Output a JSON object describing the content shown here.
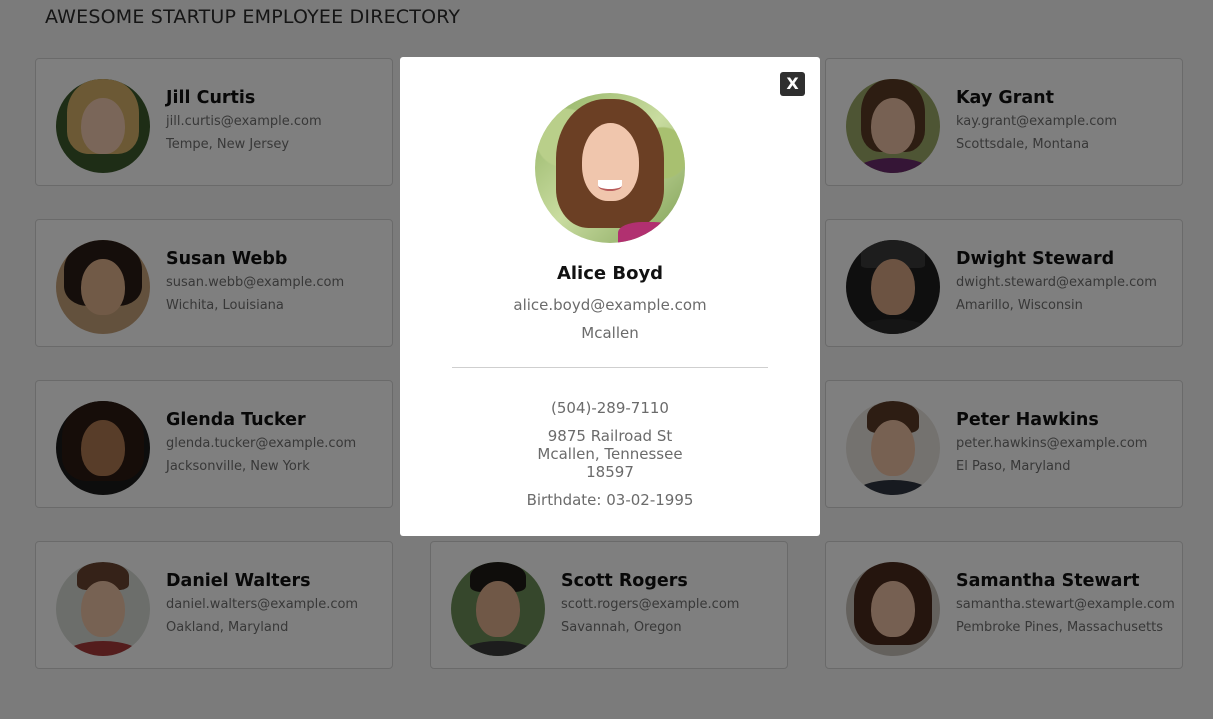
{
  "page": {
    "title": "AWESOME STARTUP EMPLOYEE DIRECTORY"
  },
  "employees": [
    {
      "name": "Jill Curtis",
      "email": "jill.curtis@example.com",
      "location": "Tempe, New Jersey"
    },
    {
      "name": "Kay Grant",
      "email": "kay.grant@example.com",
      "location": "Scottsdale, Montana"
    },
    {
      "name": "Susan Webb",
      "email": "susan.webb@example.com",
      "location": "Wichita, Louisiana"
    },
    {
      "name": "Dwight Steward",
      "email": "dwight.steward@example.com",
      "location": "Amarillo, Wisconsin"
    },
    {
      "name": "Glenda Tucker",
      "email": "glenda.tucker@example.com",
      "location": "Jacksonville, New York"
    },
    {
      "name": "Peter Hawkins",
      "email": "peter.hawkins@example.com",
      "location": "El Paso, Maryland"
    },
    {
      "name": "Daniel Walters",
      "email": "daniel.walters@example.com",
      "location": "Oakland, Maryland"
    },
    {
      "name": "Scott Rogers",
      "email": "scott.rogers@example.com",
      "location": "Savannah, Oregon"
    },
    {
      "name": "Samantha Stewart",
      "email": "samantha.stewart@example.com",
      "location": "Pembroke Pines, Massachusetts"
    }
  ],
  "modal": {
    "close_label": "X",
    "name": "Alice Boyd",
    "email": "alice.boyd@example.com",
    "city": "Mcallen",
    "phone": "(504)-289-7110",
    "street": "9875 Railroad St",
    "city_state": "Mcallen, Tennessee",
    "postcode": "18597",
    "birthdate": "Birthdate: 03-02-1995"
  },
  "colors": {
    "overlay": "#000000",
    "card_border": "#d5d5d5",
    "close_button_bg": "#2f2f2f",
    "secondary_text": "#707070"
  }
}
